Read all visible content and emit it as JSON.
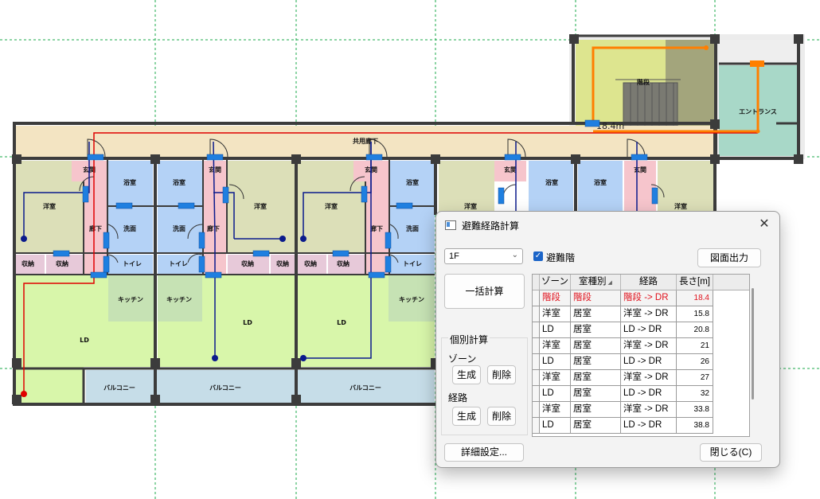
{
  "plan": {
    "labels": {
      "stairs": "階段",
      "entrance": "エントランス",
      "corridor": "共用廊下",
      "genkan": "玄関",
      "bath": "浴室",
      "washroom": "洗面",
      "western": "洋室",
      "hall": "廊下",
      "toilet": "トイレ",
      "storage": "収納",
      "kitchen": "キッチン",
      "ld": "LD",
      "balcony": "バルコニー"
    },
    "route_length_label": "18.4m",
    "colors": {
      "route_selected": "#ff7f00",
      "route_red": "#e00000",
      "route_blue": "#0a1a8c",
      "door_marker": "#1f7fe0",
      "grid": "#1aa84a",
      "wall": "#3c3c3c"
    }
  },
  "dialog": {
    "title": "避難経路計算",
    "close_glyph": "✕",
    "floor_select": "1F",
    "evac_floor_checkbox": "避難階",
    "evac_floor_checked": true,
    "export_button": "図面出力",
    "bulk_calc_button": "一括計算",
    "individual_calc_group": "個別計算",
    "zone_label": "ゾーン",
    "route_label": "経路",
    "generate_label": "生成",
    "delete_label": "削除",
    "detail_settings_button": "詳細設定...",
    "close_button": "閉じる(C)",
    "table": {
      "headers": [
        "ゾーン",
        "室種別",
        "経路",
        "長さ[m]"
      ],
      "rows": [
        {
          "zone": "階段",
          "room_type": "階段",
          "route": "階段 -> DR",
          "length": "18.4",
          "selected": true
        },
        {
          "zone": "洋室",
          "room_type": "居室",
          "route": "洋室 -> DR",
          "length": "15.8"
        },
        {
          "zone": "LD",
          "room_type": "居室",
          "route": "LD -> DR",
          "length": "20.8"
        },
        {
          "zone": "洋室",
          "room_type": "居室",
          "route": "洋室 -> DR",
          "length": "21"
        },
        {
          "zone": "LD",
          "room_type": "居室",
          "route": "LD -> DR",
          "length": "26"
        },
        {
          "zone": "洋室",
          "room_type": "居室",
          "route": "洋室 -> DR",
          "length": "27"
        },
        {
          "zone": "LD",
          "room_type": "居室",
          "route": "LD -> DR",
          "length": "32"
        },
        {
          "zone": "洋室",
          "room_type": "居室",
          "route": "洋室 -> DR",
          "length": "33.8"
        },
        {
          "zone": "LD",
          "room_type": "居室",
          "route": "LD -> DR",
          "length": "38.8"
        }
      ]
    }
  }
}
